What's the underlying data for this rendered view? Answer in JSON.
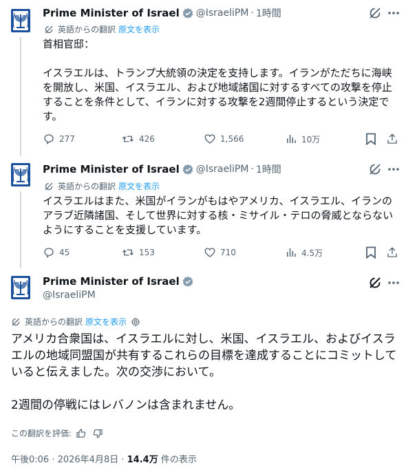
{
  "author": {
    "name": "Prime Minister of Israel",
    "handle": "@IsraeliPM"
  },
  "translation": {
    "label": "英語からの翻訳",
    "show_original": "原文を表示"
  },
  "posts": [
    {
      "time": "1時間",
      "body": "首相官邸：\n\nイスラエルは、トランプ大統領の決定を支持します。イランがただちに海峡\nを開放し、米国、イスラエル、および地域諸国に対するすべての攻撃を停止\nすることを条件として、イランに対する攻撃を2週間停止するという決定で\nす。",
      "replies": "277",
      "reposts": "426",
      "likes": "1,566",
      "views": "10万"
    },
    {
      "time": "1時間",
      "body": "イスラエルはまた、米国がイランがもはやアメリカ、イスラエル、イランの\nアラブ近隣諸国、そして世界に対する核・ミサイル・テロの脅威とならない\nようにすることを支援しています。",
      "replies": "45",
      "reposts": "153",
      "likes": "710",
      "views": "4.5万"
    },
    {
      "body": "アメリカ合衆国は、イスラエルに対し、米国、イスラエル、およびイスラ\nエルの地域同盟国が共有するこれらの目標を達成することにコミットして\nいると伝えました。次の交渉において。\n\n2週間の停戦にはレバノンは含まれません。",
      "rate_label": "この翻訳を評価:",
      "timestamp": "午後0:06 · 2026年4月8日 · ",
      "views_count": "14.4万",
      "views_label": " 件の表示"
    }
  ],
  "colors": {
    "accent": "#1d9bf0",
    "muted": "#536471",
    "text": "#0f1419",
    "badge": "#829aab",
    "emblem": "#1a4f9c"
  }
}
